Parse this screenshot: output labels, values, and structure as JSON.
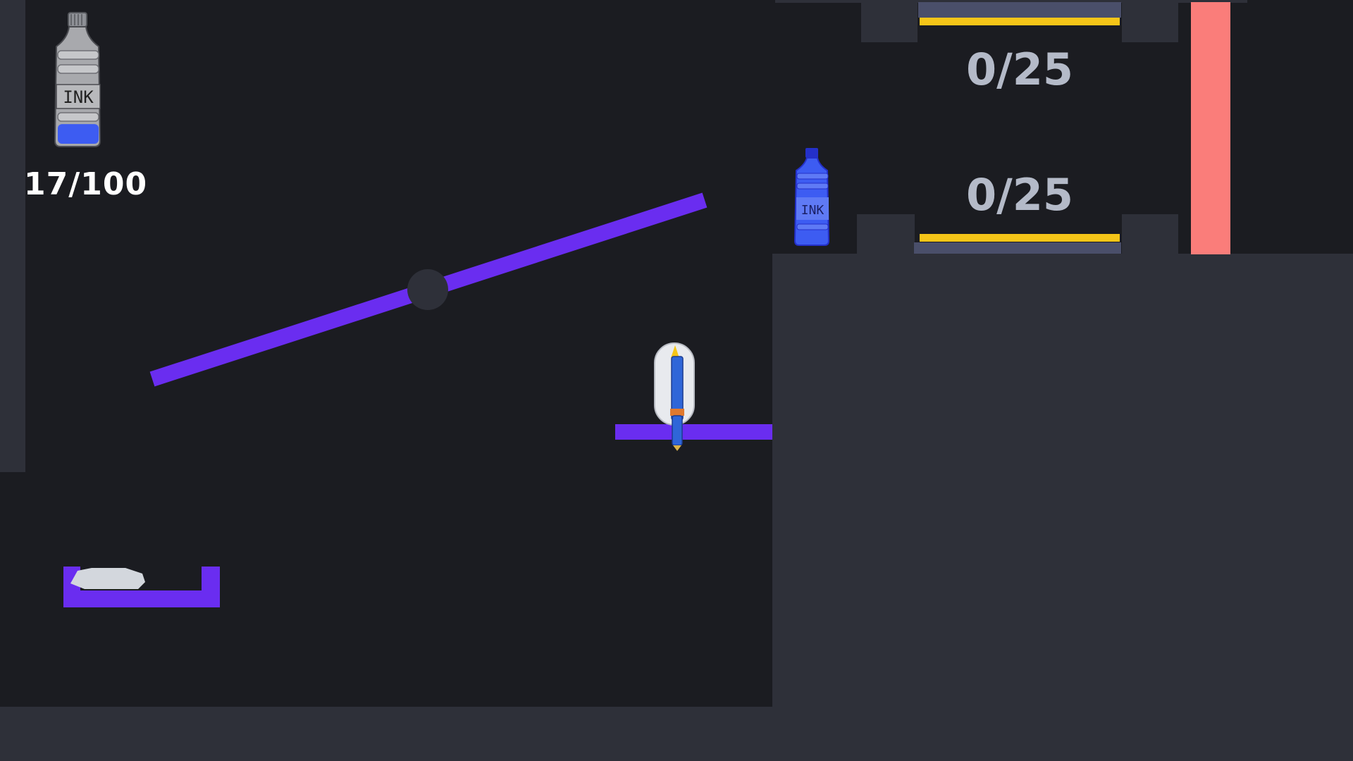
{
  "hud": {
    "ink_amount": "17/100",
    "ink_fill_fraction": 0.17,
    "ink_bottle_icon_label": "INK"
  },
  "goals": {
    "upper_counter": "0/25",
    "lower_counter": "0/25"
  },
  "pickup_bottle": {
    "label": "INK"
  },
  "colors": {
    "background": "#1b1c21",
    "wall": "#2e3039",
    "platform": "#6a2df0",
    "goal_bar": "#f5c518",
    "goal_bar_base": "#4a4f6a",
    "counter_text": "#b4bac8",
    "hazard": "#fa7d7a",
    "ink_blue": "#3d5cf2"
  },
  "icons": {
    "hud_bottle": "ink-bottle-icon",
    "pen": "fountain-pen-icon",
    "pickup": "ink-bottle-icon",
    "spawner": "rock-icon"
  }
}
